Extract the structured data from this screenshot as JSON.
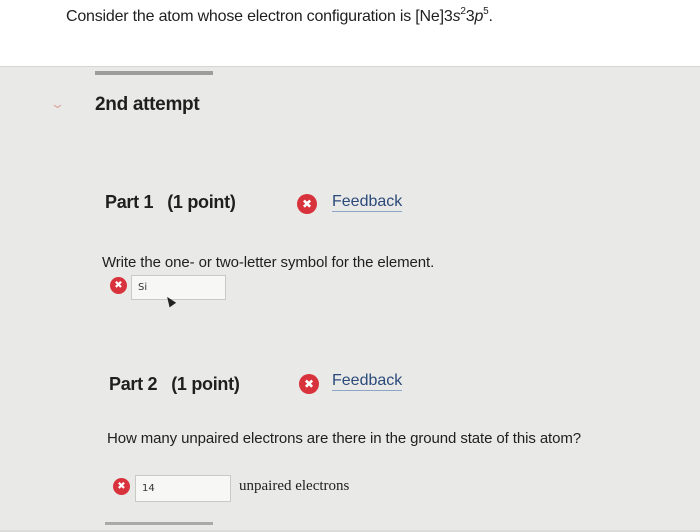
{
  "question": {
    "prefix": "Consider the atom whose electron configuration is [Ne]3",
    "s": "s",
    "sup1": "2",
    "mid": "3",
    "p": "p",
    "sup2": "5",
    "suffix": "."
  },
  "attempt": {
    "label": "2nd attempt"
  },
  "parts": [
    {
      "title": "Part 1",
      "points": "(1 point)",
      "feedback_label": "Feedback",
      "prompt": "Write the one- or two-letter symbol for the element.",
      "answer_value": "Si"
    },
    {
      "title": "Part 2",
      "points": "(1 point)",
      "feedback_label": "Feedback",
      "prompt": "How many unpaired electrons are there in the ground state of this atom?",
      "answer_value": "14",
      "units": "unpaired electrons"
    }
  ],
  "icons": {
    "status": "x-circle-icon",
    "toggle": "chevron-down-icon"
  },
  "colors": {
    "error": "#d8333c",
    "link": "#2b4a7a"
  }
}
